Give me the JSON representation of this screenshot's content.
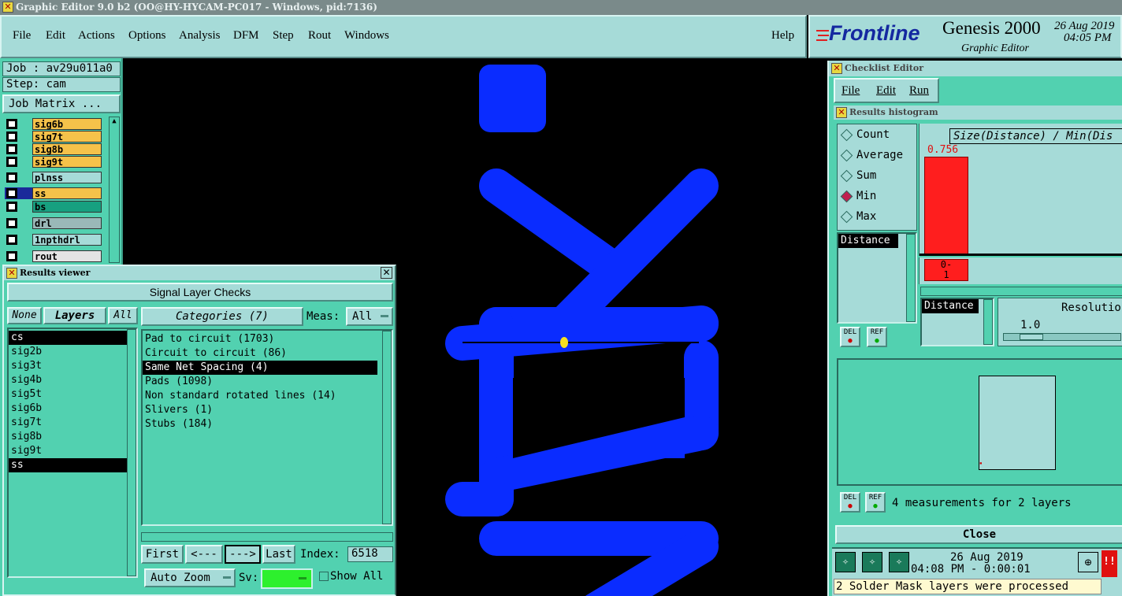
{
  "window_title": "Graphic Editor 9.0 b2 (OO@HY-HYCAM-PC017 - Windows, pid:7136)",
  "menu": [
    "File",
    "Edit",
    "Actions",
    "Options",
    "Analysis",
    "DFM",
    "Step",
    "Rout",
    "Windows"
  ],
  "help": "Help",
  "brand": {
    "logo": "Frontline",
    "product": "Genesis 2000",
    "subtitle": "Graphic Editor",
    "date": "26 Aug 2019",
    "time": "04:05 PM"
  },
  "job": {
    "job_label": "Job : av29u011a0",
    "step_label": "Step: cam",
    "matrix_button": "Job Matrix ..."
  },
  "layers": [
    {
      "name": "sig6b",
      "color": "#f5c24a"
    },
    {
      "name": "sig7t",
      "color": "#f5c24a"
    },
    {
      "name": "sig8b",
      "color": "#f5c24a"
    },
    {
      "name": "sig9t",
      "color": "#f5c24a"
    },
    {
      "name": "plnss",
      "color": "#a6dbd8"
    },
    {
      "name": "ss",
      "color": "#f5c24a"
    },
    {
      "name": "bs",
      "color": "#17a080"
    },
    {
      "name": "drl",
      "color": "#9ab8b8"
    },
    {
      "name": "1npthdrl",
      "color": "#a6dbd8"
    },
    {
      "name": "rout",
      "color": "#e4e4e4"
    }
  ],
  "results_viewer": {
    "title": "Results viewer",
    "header": "Signal Layer Checks",
    "none": "None",
    "layers_btn": "Layers",
    "all": "All",
    "categories_btn": "Categories (7)",
    "meas_label": "Meas:",
    "meas_value": "All",
    "layer_list": [
      "cs",
      "sig2b",
      "sig3t",
      "sig4b",
      "sig5t",
      "sig6b",
      "sig7t",
      "sig8b",
      "sig9t",
      "ss"
    ],
    "category_list": [
      "Pad to circuit (1703)",
      "Circuit to circuit (86)",
      "Same Net Spacing (4)",
      "Pads (1098)",
      "Non standard rotated lines (14)",
      "Slivers (1)",
      "Stubs (184)"
    ],
    "first": "First",
    "prev": "<---",
    "next": "--->",
    "last": "Last",
    "index_label": "Index:",
    "index_value": "6518",
    "auto_zoom": "Auto Zoom",
    "sv_label": "Sv:",
    "show_all": "Show All"
  },
  "checklist": {
    "title": "Checklist Editor",
    "menu": [
      "File",
      "Edit",
      "Run"
    ],
    "hist_title": "Results histogram",
    "radios": [
      "Count",
      "Average",
      "Sum",
      "Min",
      "Max"
    ],
    "selected_radio": "Min",
    "distance": "Distance",
    "chart_header": "Size(Distance) / Min(Dis",
    "bar_value": "0.756",
    "bar_label_a": "0-",
    "bar_label_b": "1",
    "distance2": "Distance",
    "resolution_label": "Resolutio",
    "resolution_value": "1.0",
    "del": "DEL",
    "ref": "REF",
    "measurements": "4 measurements for 2 layers",
    "close": "Close",
    "status_date": "26 Aug 2019",
    "status_time": "04:08 PM - 0:00:01",
    "status_msg": "2 Solder Mask layers were processed"
  },
  "colors": {
    "teal": "#52d1b0",
    "light": "#a6dbd8",
    "trace": "#0a2cff",
    "bar": "#ff1e1e"
  }
}
